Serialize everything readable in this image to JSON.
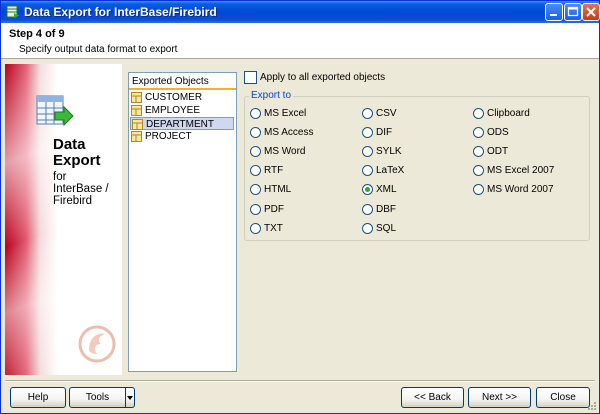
{
  "window": {
    "title": "Data Export for InterBase/Firebird"
  },
  "step": {
    "title": "Step 4 of 9",
    "description": "Specify output data format to export"
  },
  "banner": {
    "big_line1": "Data",
    "big_line2": "Export",
    "small_line1": "for",
    "small_line2": "InterBase /",
    "small_line3": "Firebird"
  },
  "objects": {
    "header": "Exported Objects",
    "items": [
      {
        "label": "CUSTOMER"
      },
      {
        "label": "EMPLOYEE"
      },
      {
        "label": "DEPARTMENT"
      },
      {
        "label": "PROJECT"
      }
    ],
    "selected_index": 2
  },
  "apply_all": {
    "label": "Apply to all exported objects",
    "checked": false
  },
  "export_to": {
    "label": "Export to",
    "selected": "XML",
    "columns": [
      [
        "MS Excel",
        "MS Access",
        "MS Word",
        "RTF",
        "HTML",
        "PDF",
        "TXT"
      ],
      [
        "CSV",
        "DIF",
        "SYLK",
        "LaTeX",
        "XML",
        "DBF",
        "SQL"
      ],
      [
        "Clipboard",
        "ODS",
        "ODT",
        "MS Excel 2007",
        "MS Word 2007"
      ]
    ]
  },
  "buttons": {
    "help": "Help",
    "tools": "Tools",
    "back": "<< Back",
    "next": "Next >>",
    "close": "Close"
  },
  "colors": {
    "titlebar": "#0046d5",
    "accent_group": "#0046d5",
    "selected_radio": "#2fa82f"
  }
}
